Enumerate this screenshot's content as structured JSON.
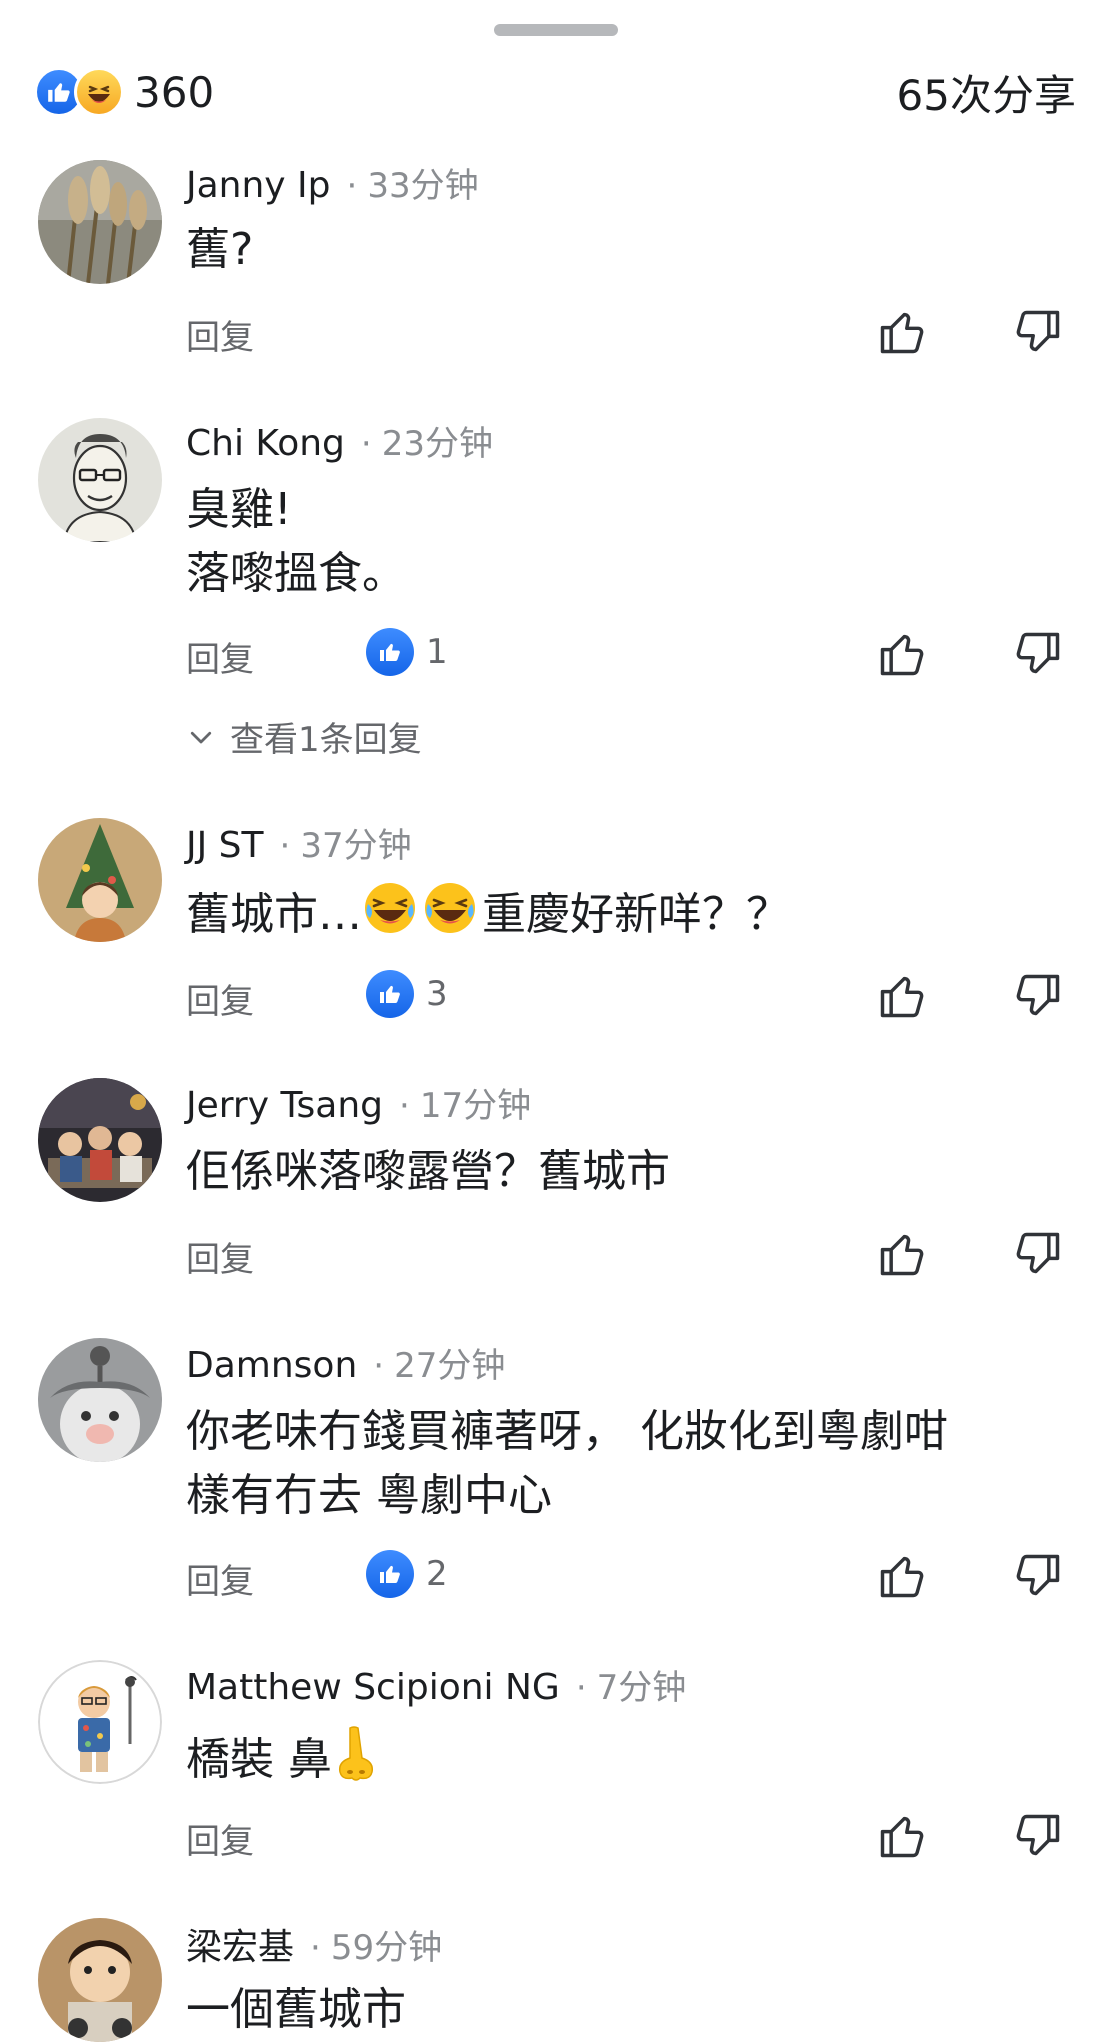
{
  "header": {
    "reaction_count": "360",
    "share_count": "65次分享"
  },
  "comments": [
    {
      "name": "Janny Ip",
      "time": "33分钟",
      "lines": [
        "舊?"
      ],
      "reply_label": "回复",
      "likes": ""
    },
    {
      "name": "Chi Kong",
      "time": "23分钟",
      "lines": [
        "臭雞!",
        "落嚟搵食。"
      ],
      "reply_label": "回复",
      "likes": "1",
      "view_replies": "查看1条回复"
    },
    {
      "name": "JJ ST",
      "time": "37分钟",
      "lines": [
        "舊城市…",
        "重慶好新咩？？"
      ],
      "reply_label": "回复",
      "likes": "3"
    },
    {
      "name": "Jerry Tsang",
      "time": "17分钟",
      "lines": [
        "佢係咪落嚟露營？舊城市"
      ],
      "reply_label": "回复",
      "likes": ""
    },
    {
      "name": "Damnson",
      "time": "27分钟",
      "lines": [
        "你老味冇錢買褲著呀， 化妝化到粵劇咁",
        "樣有冇去 粵劇中心"
      ],
      "reply_label": "回复",
      "likes": "2"
    },
    {
      "name": "Matthew Scipioni NG",
      "time": "7分钟",
      "lines": [
        "橋裝 鼻"
      ],
      "reply_label": "回复",
      "likes": ""
    },
    {
      "name": "梁宏基",
      "time": "59分钟",
      "lines": [
        "一個舊城市"
      ],
      "reply_label": "",
      "likes": ""
    }
  ],
  "icons": {
    "like": "thumbs-up-icon",
    "dislike": "thumbs-down-icon",
    "expand": "chevron-down-icon",
    "laugh": "laughing-emoji",
    "nose": "nose-emoji"
  },
  "colors": {
    "like_blue": "#1877f2",
    "secondary_text": "#65676b",
    "meta_text": "#8a8d91"
  }
}
